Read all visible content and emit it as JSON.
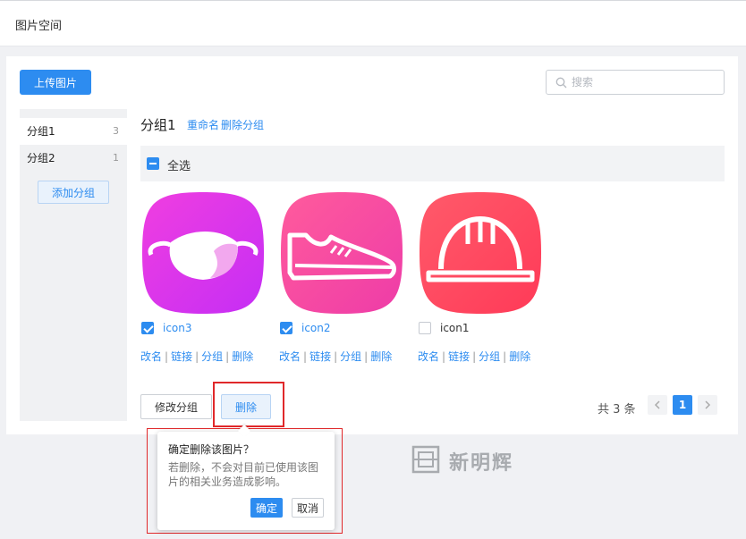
{
  "topbar": {
    "title": "图片空间"
  },
  "toolbar": {
    "upload_label": "上传图片"
  },
  "search": {
    "placeholder": "搜索",
    "value": ""
  },
  "sidebar": {
    "items": [
      {
        "label": "分组1",
        "count": "3",
        "active": true
      },
      {
        "label": "分组2",
        "count": "1",
        "active": false
      }
    ],
    "add_label": "添加分组"
  },
  "group": {
    "title": "分组1",
    "rename_label": "重命名",
    "delete_label": "删除分组"
  },
  "select_all": {
    "label": "全选",
    "state": "indeterminate"
  },
  "images": [
    {
      "name": "icon3",
      "checked": true,
      "icon": "mask-icon",
      "gradient": [
        "#f03ee0",
        "#c52ef5"
      ]
    },
    {
      "name": "icon2",
      "checked": true,
      "icon": "shoe-icon",
      "gradient": [
        "#ff5b9c",
        "#ee3ca8"
      ]
    },
    {
      "name": "icon1",
      "checked": false,
      "icon": "helmet-icon",
      "gradient": [
        "#ff5a6a",
        "#ff3a58"
      ]
    }
  ],
  "image_actions": {
    "rename": "改名",
    "link": "链接",
    "group": "分组",
    "delete": "删除"
  },
  "bottom_actions": {
    "modify_group_label": "修改分组",
    "delete_label": "删除"
  },
  "pagination": {
    "total_text": "共 3 条",
    "current_page": "1"
  },
  "popover": {
    "title": "确定删除该图片？",
    "description": "若删除，不会对目前已使用该图片的相关业务造成影响。",
    "ok_label": "确定",
    "cancel_label": "取消"
  },
  "watermark": {
    "text": "新明辉"
  },
  "colors": {
    "primary": "#2d8cf0",
    "highlight_box": "#e0282a"
  }
}
